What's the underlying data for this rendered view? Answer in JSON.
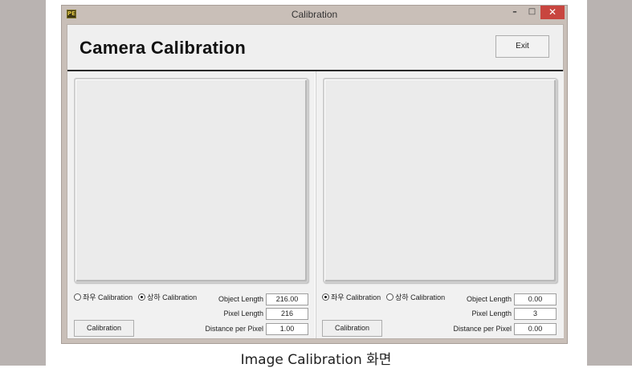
{
  "window": {
    "title": "Calibration",
    "controls": {
      "minimize": "–",
      "maximize": "□",
      "close": "✕"
    },
    "app_icon_text": "PE"
  },
  "header": {
    "title": "Camera Calibration",
    "exit_label": "Exit"
  },
  "panels": [
    {
      "radio_lr": "좌우 Calibration",
      "radio_ud": "상하 Calibration",
      "selected": "ud",
      "object_length_label": "Object Length",
      "object_length_value": "216.00",
      "pixel_length_label": "Pixel Length",
      "pixel_length_value": "216",
      "distance_label": "Distance per Pixel",
      "distance_value": "1.00",
      "button_label": "Calibration"
    },
    {
      "radio_lr": "좌우 Calibration",
      "radio_ud": "상하 Calibration",
      "selected": "lr",
      "object_length_label": "Object Length",
      "object_length_value": "0.00",
      "pixel_length_label": "Pixel Length",
      "pixel_length_value": "3",
      "distance_label": "Distance per Pixel",
      "distance_value": "0.00",
      "button_label": "Calibration"
    }
  ],
  "caption": "Image Calibration 화면"
}
